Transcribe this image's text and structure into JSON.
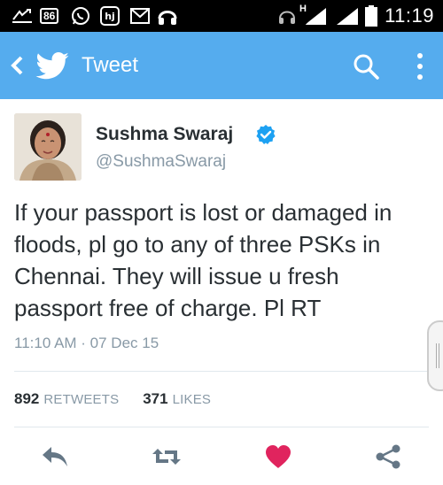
{
  "status_bar": {
    "badge": "86",
    "network_type": "H",
    "time": "11:19",
    "icons": [
      "sms-icon",
      "whatsapp-icon",
      "hj-app-icon",
      "gmail-icon",
      "headphones-icon",
      "headset-icon",
      "signal-icon",
      "battery-icon"
    ]
  },
  "app_bar": {
    "title": "Tweet",
    "background": "#55acee",
    "icons": [
      "back-icon",
      "twitter-bird-icon",
      "search-icon",
      "overflow-menu-icon"
    ]
  },
  "tweet": {
    "author_name": "Sushma Swaraj",
    "author_handle": "@SushmaSwaraj",
    "verified": true,
    "text": "If your passport is lost or damaged in floods, pl go to any of three PSKs in Chennai. They will issue u fresh passport free of charge. Pl RT",
    "timestamp": "11:10 AM · 07 Dec 15",
    "retweets_count": "892",
    "retweets_label": "RETWEETS",
    "likes_count": "371",
    "likes_label": "LIKES"
  },
  "actions": [
    "reply-icon",
    "retweet-icon",
    "like-icon",
    "share-icon"
  ],
  "colors": {
    "accent": "#55acee",
    "like": "#e0245e",
    "text_primary": "#292f33",
    "text_secondary": "#8899a6",
    "verified": "#1da1f2"
  }
}
